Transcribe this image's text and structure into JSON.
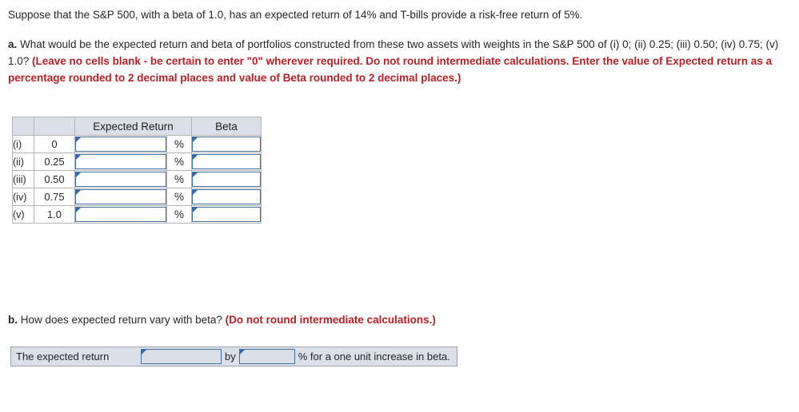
{
  "intro": {
    "text": "Suppose that the S&P 500, with a beta of 1.0, has an expected return of 14% and T-bills provide a risk-free return of 5%."
  },
  "part_a": {
    "marker": "a.",
    "prompt": " What would be the expected return and beta of portfolios constructed from these two assets with weights in the S&P 500 of (i) 0; (ii) 0.25; (iii) 0.50; (iv) 0.75; (v) 1.0? ",
    "instruction_bold_red": "(Leave no cells blank - be certain to enter \"0\" wherever required. Do not round intermediate calculations. Enter the value of Expected return as a percentage rounded to 2 decimal places and value of Beta rounded to 2 decimal places.)",
    "table": {
      "headers": [
        "",
        "",
        "Expected Return",
        "Beta"
      ],
      "rows": [
        {
          "roman": "(i)",
          "weight": "0",
          "expected_return": "",
          "percent_suffix": "%",
          "beta": ""
        },
        {
          "roman": "(ii)",
          "weight": "0.25",
          "expected_return": "",
          "percent_suffix": "%",
          "beta": ""
        },
        {
          "roman": "(iii)",
          "weight": "0.50",
          "expected_return": "",
          "percent_suffix": "%",
          "beta": ""
        },
        {
          "roman": "(iv)",
          "weight": "0.75",
          "expected_return": "",
          "percent_suffix": "%",
          "beta": ""
        },
        {
          "roman": "(v)",
          "weight": "1.0",
          "expected_return": "",
          "percent_suffix": "%",
          "beta": ""
        }
      ]
    }
  },
  "part_b": {
    "marker": "b.",
    "prompt": " How does expected return vary with beta? ",
    "instruction_bold_red": "(Do not round intermediate calculations.)",
    "answer_bar": {
      "lead_label": "The expected return",
      "direction_value": "",
      "middle_label": "by",
      "amount_value": "",
      "tail_label": "% for a one unit increase in beta."
    }
  },
  "colors": {
    "red_accent": "#bc2026",
    "input_border": "#3f6f9f",
    "header_fill": "#dbdfe8",
    "text": "#262626"
  }
}
